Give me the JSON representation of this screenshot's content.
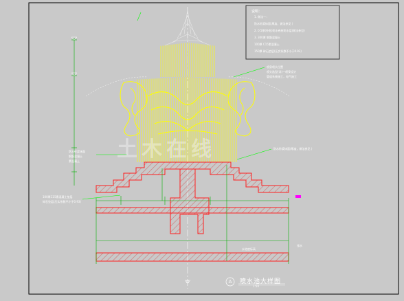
{
  "colors": {
    "background": "#c9c9c9",
    "frame": "#000000",
    "concrete_outline": "#ff2020",
    "hatch": "#d07070",
    "water_jets": "#ffff00",
    "sculpture": "#ffff00",
    "dims": "#00b000",
    "leader": "#00ff00",
    "notes_text": "#ffffff",
    "marker": "#ff00ff"
  },
  "notes": {
    "title": "说明：",
    "lines": [
      "1. 做法一：",
      "防水砂浆抹面(厚度，做法参见 )",
      "2. 0.5厚(外贴)防水卷材防水层(做法参见)",
      "3. 300厚 钢筋混凝土",
      "100厚 C15素混凝土",
      "150厚 碎石垫层(压实系数不小于0.93)"
    ]
  },
  "labels": {
    "jet_callout": [
      "喷泉喷头位置",
      "喷头选型(详)一喷泉设计",
      "管道系统施工，电气施工"
    ],
    "left_callout_1": [
      "防水砂浆抹面",
      "钢筋混凝土",
      "素混凝土"
    ],
    "left_callout_2": [
      "100厚C15素混凝土垫层",
      "碎石垫层(压实系数不小于0.93)"
    ],
    "right_callout_1": "防水砂浆抹面(厚度，做法参见 )",
    "right_callout_2": "排水",
    "bottom_dim": "水池底标高"
  },
  "watermark": "土木在线",
  "title_block": {
    "letter": "A",
    "title": "喷水池大样图",
    "scale": "1:50"
  }
}
